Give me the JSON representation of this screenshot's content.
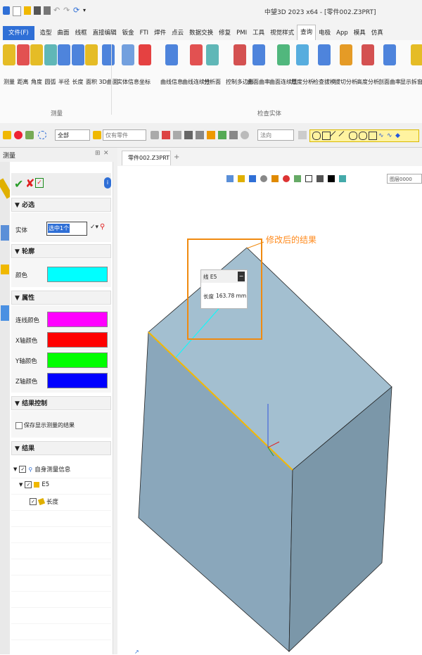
{
  "window": {
    "title": "中望3D 2023 x64 - [零件002.Z3PRT]"
  },
  "menu": [
    {
      "label": "文件(F)",
      "kind": "file"
    },
    {
      "label": "造型"
    },
    {
      "label": "曲面"
    },
    {
      "label": "线框"
    },
    {
      "label": "直接编辑"
    },
    {
      "label": "钣金"
    },
    {
      "label": "FTI"
    },
    {
      "label": "焊件"
    },
    {
      "label": "点云"
    },
    {
      "label": "数据交换"
    },
    {
      "label": "修复"
    },
    {
      "label": "PMI"
    },
    {
      "label": "工具"
    },
    {
      "label": "视觉样式"
    },
    {
      "label": "查询",
      "kind": "active"
    },
    {
      "label": "电极"
    },
    {
      "label": "App"
    },
    {
      "label": "模具"
    },
    {
      "label": "仿真"
    }
  ],
  "ribbon": {
    "measure_group": "测量",
    "inspect_group": "检查实体",
    "measure_tools": [
      "测量",
      "距离",
      "角度",
      "圆弧",
      "半径",
      "长度",
      "面积",
      "3D曲面"
    ],
    "inspect_tools": [
      "实体信息",
      "坐标",
      "曲线信息",
      "曲线连续性",
      "分析面",
      "控制多边形",
      "曲面曲率",
      "曲面连续性",
      "厚度分析",
      "检查拔模",
      "拔切分析",
      "高度分析",
      "剖面曲率",
      "显示拆窗信息"
    ]
  },
  "toolbar2": {
    "filter_value": "全部",
    "part_filter": "仅有零件",
    "direction": "法向"
  },
  "panel": {
    "title": "测量",
    "sections": {
      "required": "必选",
      "outline": "轮廓",
      "properties": "属性",
      "result_control": "结果控制",
      "results": "结果"
    },
    "entity_label": "实体",
    "entity_value": "选中1个",
    "color_label": "颜色",
    "color_value": "#00ffff",
    "props": [
      {
        "label": "连线颜色",
        "color": "#ff00ff"
      },
      {
        "label": "X轴颜色",
        "color": "#ff0000"
      },
      {
        "label": "Y轴颜色",
        "color": "#00ff00"
      },
      {
        "label": "Z轴颜色",
        "color": "#0000ff"
      }
    ],
    "keep_label": "保存显示测量的结果",
    "tree": {
      "root": "自身测量信息",
      "child": "E5",
      "leaf": "长度"
    }
  },
  "viewport": {
    "tab": "零件002.Z3PRT",
    "tab_close": "X",
    "tab_add": "+",
    "view_label": "图层0000",
    "annotation": "修改后的结果",
    "label_line": "线 E5",
    "label_length_key": "长度",
    "label_length_val": "163.78 mm",
    "accent": "#ff8a1c"
  }
}
